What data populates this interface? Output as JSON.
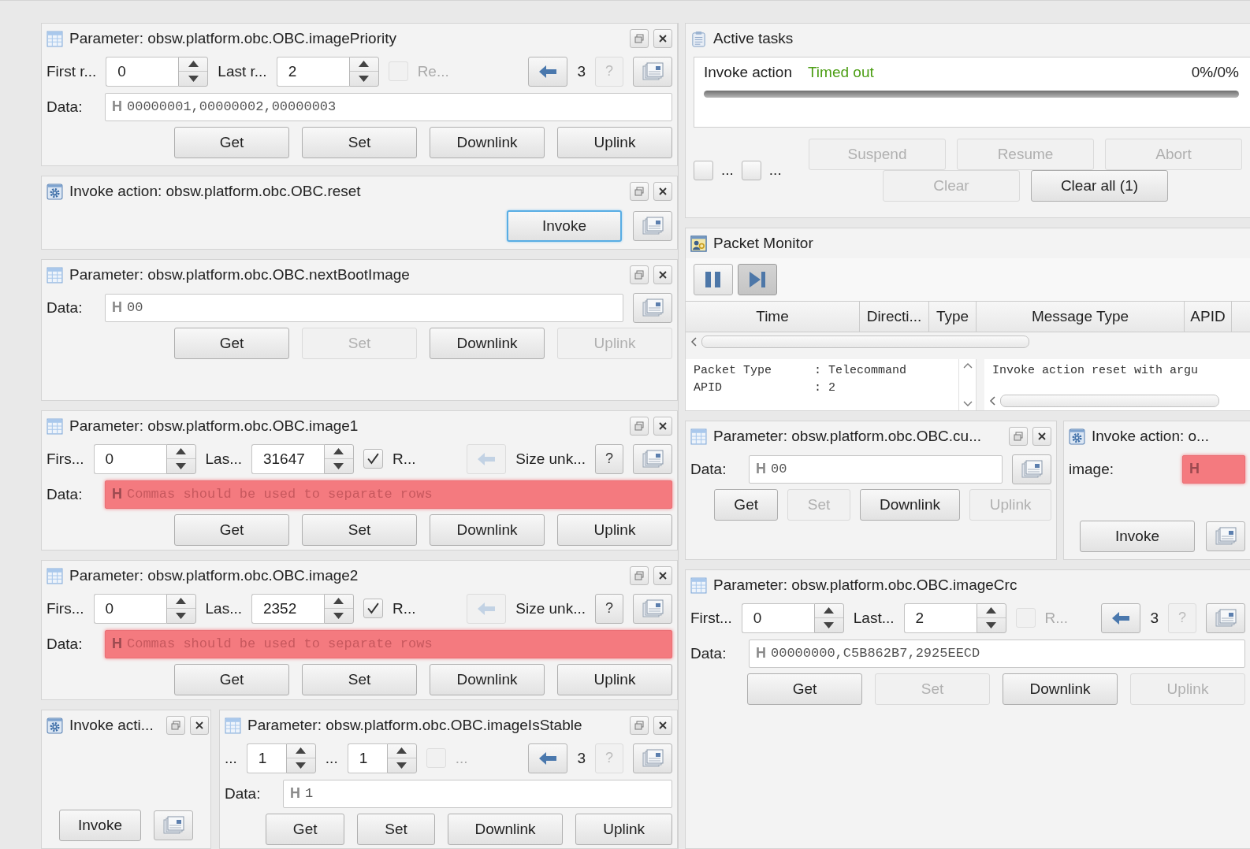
{
  "left_panels": [
    {
      "kind": "parameter",
      "title": "Parameter: obsw.platform.obc.OBC.imagePriority",
      "window_buttons": true,
      "range": {
        "first_label": "First r...",
        "first_value": "0",
        "last_label": "Last r...",
        "last_value": "2",
        "repeat": {
          "label": "Re...",
          "checked": false,
          "disabled": true
        },
        "back_disabled": false,
        "size": "3",
        "help_label": "?",
        "help_disabled": true
      },
      "data": {
        "label": "Data:",
        "format": "H",
        "value": "00000001,00000002,00000003",
        "invalid": false
      },
      "buttons": [
        {
          "label": "Get",
          "disabled": false
        },
        {
          "label": "Set",
          "disabled": false
        },
        {
          "label": "Downlink",
          "disabled": false
        },
        {
          "label": "Uplink",
          "disabled": false
        }
      ]
    },
    {
      "kind": "invoke",
      "title": "Invoke action: obsw.platform.obc.OBC.reset",
      "window_buttons": true,
      "invoke_button": {
        "label": "Invoke",
        "focused": true
      }
    },
    {
      "kind": "parameter",
      "title": "Parameter: obsw.platform.obc.OBC.nextBootImage",
      "window_buttons": true,
      "data": {
        "label": "Data:",
        "format": "H",
        "value": "00",
        "invalid": false
      },
      "buttons": [
        {
          "label": "Get",
          "disabled": false
        },
        {
          "label": "Set",
          "disabled": true
        },
        {
          "label": "Downlink",
          "disabled": false
        },
        {
          "label": "Uplink",
          "disabled": true
        }
      ]
    },
    {
      "kind": "parameter",
      "title": "Parameter: obsw.platform.obc.OBC.image1",
      "window_buttons": true,
      "range": {
        "first_label": "Firs...",
        "first_value": "0",
        "last_label": "Las...",
        "last_value": "31647",
        "repeat": {
          "label": "R...",
          "checked": true,
          "disabled": false
        },
        "back_disabled": true,
        "size": "Size unk...",
        "help_label": "?",
        "help_disabled": false
      },
      "data": {
        "label": "Data:",
        "format": "H",
        "placeholder": "Commas should be used to separate rows",
        "invalid": true
      },
      "buttons": [
        {
          "label": "Get",
          "disabled": false
        },
        {
          "label": "Set",
          "disabled": false
        },
        {
          "label": "Downlink",
          "disabled": false
        },
        {
          "label": "Uplink",
          "disabled": false
        }
      ]
    },
    {
      "kind": "parameter",
      "title": "Parameter: obsw.platform.obc.OBC.image2",
      "window_buttons": true,
      "range": {
        "first_label": "Firs...",
        "first_value": "0",
        "last_label": "Las...",
        "last_value": "2352",
        "repeat": {
          "label": "R...",
          "checked": true,
          "disabled": false
        },
        "back_disabled": true,
        "size": "Size unk...",
        "help_label": "?",
        "help_disabled": false
      },
      "data": {
        "label": "Data:",
        "format": "H",
        "placeholder": "Commas should be used to separate rows",
        "invalid": true
      },
      "buttons": [
        {
          "label": "Get",
          "disabled": false
        },
        {
          "label": "Set",
          "disabled": false
        },
        {
          "label": "Downlink",
          "disabled": false
        },
        {
          "label": "Uplink",
          "disabled": false
        }
      ]
    }
  ],
  "bottom_left_panels": [
    {
      "kind": "invoke",
      "title": "Invoke acti...",
      "window_buttons": true,
      "invoke_button": {
        "label": "Invoke",
        "focused": false
      }
    },
    {
      "kind": "parameter",
      "title": "Parameter: obsw.platform.obc.OBC.imageIsStable",
      "window_buttons": true,
      "range": {
        "first_label": "...",
        "first_value": "1",
        "last_label": "...",
        "last_value": "1",
        "repeat": {
          "label": "...",
          "checked": false,
          "disabled": true
        },
        "back_disabled": false,
        "size": "3",
        "help_label": "?",
        "help_disabled": true
      },
      "data": {
        "label": "Data:",
        "format": "H",
        "value": "1",
        "invalid": false
      },
      "buttons": [
        {
          "label": "Get",
          "disabled": false
        },
        {
          "label": "Set",
          "disabled": false
        },
        {
          "label": "Downlink",
          "disabled": false
        },
        {
          "label": "Uplink",
          "disabled": false
        }
      ]
    }
  ],
  "active_tasks": {
    "title": "Active tasks",
    "tasks": [
      {
        "name": "Invoke action",
        "status": "Timed out",
        "progress": "0%/0%",
        "level": 0
      }
    ],
    "filters": [
      {
        "label": "...",
        "checked": false
      },
      {
        "label": "...",
        "checked": false
      }
    ],
    "buttons": [
      {
        "label": "Suspend",
        "disabled": true
      },
      {
        "label": "Resume",
        "disabled": true
      },
      {
        "label": "Abort",
        "disabled": true
      },
      {
        "label": "Clear",
        "disabled": true
      },
      {
        "label": "Clear all (1)",
        "disabled": false
      }
    ]
  },
  "packet_monitor": {
    "title": "Packet Monitor",
    "toolbar": [
      {
        "kind": "pause",
        "pressed": false
      },
      {
        "kind": "step",
        "pressed": true
      }
    ],
    "columns": [
      "Time",
      "Directi...",
      "Type",
      "Message Type",
      "APID"
    ],
    "detail_lines": [
      "Packet Type      : Telecommand",
      "APID             : 2"
    ],
    "raw_lines": [
      "Invoke action reset with argu"
    ]
  },
  "middle_right_panels": [
    {
      "kind": "parameter",
      "title": "Parameter: obsw.platform.obc.OBC.cu...",
      "window_buttons": true,
      "data": {
        "label": "Data:",
        "format": "H",
        "value": "00",
        "invalid": false
      },
      "buttons": [
        {
          "label": "Get",
          "disabled": false
        },
        {
          "label": "Set",
          "disabled": true
        },
        {
          "label": "Downlink",
          "disabled": false
        },
        {
          "label": "Uplink",
          "disabled": true
        }
      ]
    },
    {
      "kind": "invoke",
      "title": "Invoke action: o...",
      "window_buttons": false,
      "argument": {
        "label": "image:",
        "format": "H",
        "invalid": true
      },
      "invoke_button": {
        "label": "Invoke",
        "focused": false
      }
    }
  ],
  "right_panels": [
    {
      "kind": "parameter",
      "title": "Parameter: obsw.platform.obc.OBC.imageCrc",
      "window_buttons": false,
      "range": {
        "first_label": "First...",
        "first_value": "0",
        "last_label": "Last...",
        "last_value": "2",
        "repeat": {
          "label": "R...",
          "checked": false,
          "disabled": true
        },
        "back_disabled": false,
        "size": "3",
        "help_label": "?",
        "help_disabled": true
      },
      "data": {
        "label": "Data:",
        "format": "H",
        "value": "00000000,C5B862B7,2925EECD",
        "invalid": false
      },
      "buttons": [
        {
          "label": "Get",
          "disabled": false
        },
        {
          "label": "Set",
          "disabled": true
        },
        {
          "label": "Downlink",
          "disabled": false
        },
        {
          "label": "Uplink",
          "disabled": true
        }
      ]
    }
  ]
}
